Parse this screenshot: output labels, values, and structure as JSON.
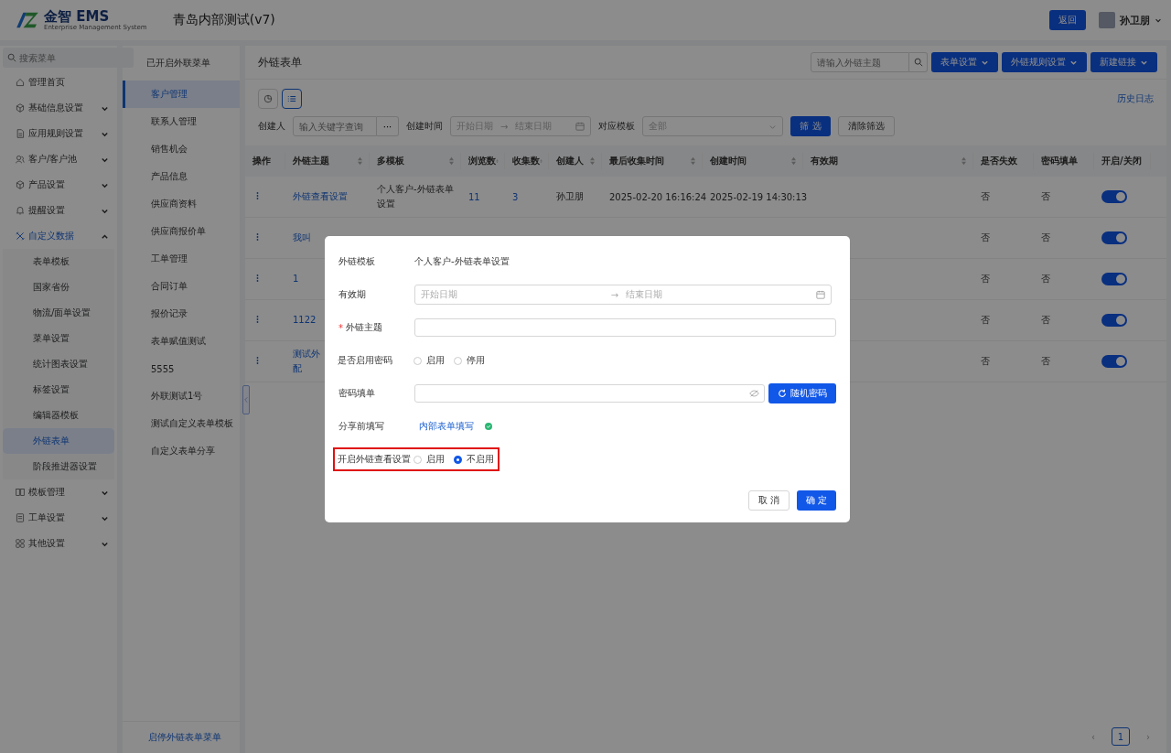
{
  "header": {
    "logo_text": "金智 EMS",
    "logo_subtitle": "Enterprise Management System",
    "title": "青岛内部测试(v7)",
    "back_button": "返回",
    "user_name": "孙卫朋"
  },
  "sidebar": {
    "search_placeholder": "搜索菜单",
    "items": [
      {
        "label": "管理首页",
        "kind": "link",
        "selected": false
      },
      {
        "label": "基础信息设置",
        "kind": "group",
        "expanded": false,
        "selected": false
      },
      {
        "label": "应用规则设置",
        "kind": "group",
        "expanded": false,
        "selected": false
      },
      {
        "label": "客户/客户池",
        "kind": "group",
        "expanded": false,
        "selected": false
      },
      {
        "label": "产品设置",
        "kind": "group",
        "expanded": false,
        "selected": false
      },
      {
        "label": "提醒设置",
        "kind": "group",
        "expanded": false,
        "selected": false
      },
      {
        "label": "自定义数据",
        "kind": "group",
        "expanded": true,
        "selected": true,
        "children": [
          {
            "label": "表单模板",
            "selected": false
          },
          {
            "label": "国家省份",
            "selected": false
          },
          {
            "label": "物流/面单设置",
            "selected": false
          },
          {
            "label": "菜单设置",
            "selected": false
          },
          {
            "label": "统计图表设置",
            "selected": false
          },
          {
            "label": "标签设置",
            "selected": false
          },
          {
            "label": "编辑器模板",
            "selected": false
          },
          {
            "label": "外链表单",
            "selected": true
          },
          {
            "label": "阶段推进器设置",
            "selected": false
          }
        ]
      },
      {
        "label": "模板管理",
        "kind": "group",
        "expanded": false,
        "selected": false
      },
      {
        "label": "工单设置",
        "kind": "group",
        "expanded": false,
        "selected": false
      },
      {
        "label": "其他设置",
        "kind": "group",
        "expanded": false,
        "selected": false
      }
    ]
  },
  "menu_panel": {
    "title": "已开启外联菜单",
    "items": [
      {
        "label": "客户管理",
        "selected": true
      },
      {
        "label": "联系人管理",
        "selected": false
      },
      {
        "label": "销售机会",
        "selected": false
      },
      {
        "label": "产品信息",
        "selected": false
      },
      {
        "label": "供应商资料",
        "selected": false
      },
      {
        "label": "供应商报价单",
        "selected": false
      },
      {
        "label": "工单管理",
        "selected": false
      },
      {
        "label": "合同订单",
        "selected": false
      },
      {
        "label": "报价记录",
        "selected": false
      },
      {
        "label": "表单赋值测试",
        "selected": false
      },
      {
        "label": "5555",
        "selected": false
      },
      {
        "label": "外联测试1号",
        "selected": false
      },
      {
        "label": "测试自定义表单模板",
        "selected": false
      },
      {
        "label": "自定义表单分享",
        "selected": false
      }
    ],
    "footer_link": "启停外链表单菜单"
  },
  "main": {
    "title": "外链表单",
    "search_placeholder": "请输入外链主题",
    "toolbar_buttons": [
      "表单设置",
      "外链规则设置",
      "新建链接"
    ],
    "views": [
      {
        "kind": "chart",
        "selected": false
      },
      {
        "kind": "list",
        "selected": true
      }
    ],
    "history_link": "历史日志",
    "filters": {
      "creator_label": "创建人",
      "creator_placeholder": "输入关键字查询",
      "more_button": "···",
      "time_label": "创建时间",
      "start_placeholder": "开始日期",
      "range_arrow": "→",
      "end_placeholder": "结束日期",
      "template_label": "对应模板",
      "template_value": "全部",
      "filter_button": "筛 选",
      "clear_button": "清除筛选"
    },
    "table": {
      "columns": [
        {
          "label": "操作",
          "sortable": false
        },
        {
          "label": "外链主题",
          "sortable": true
        },
        {
          "label": "多模板",
          "sortable": true
        },
        {
          "label": "浏览数",
          "sortable": true
        },
        {
          "label": "收集数",
          "sortable": true
        },
        {
          "label": "创建人",
          "sortable": true
        },
        {
          "label": "最后收集时间",
          "sortable": true
        },
        {
          "label": "创建时间",
          "sortable": true
        },
        {
          "label": "有效期",
          "sortable": true
        },
        {
          "label": "是否失效",
          "sortable": false
        },
        {
          "label": "密码填单",
          "sortable": false
        },
        {
          "label": "开启/关闭",
          "sortable": false
        }
      ],
      "rows": [
        {
          "subject": "外链查看设置",
          "template": "个人客户-外链表单设置",
          "views": "11",
          "collected": "3",
          "creator": "孙卫朋",
          "last_collected": "2025-02-20 16:16:24",
          "created": "2025-02-19 14:30:13",
          "invalid": "否",
          "password_form": "否",
          "on": true
        },
        {
          "subject": "我叫",
          "invalid": "否",
          "password_form": "否",
          "on": true
        },
        {
          "subject": "1",
          "invalid": "否",
          "password_form": "否",
          "on": true
        },
        {
          "subject": "1122",
          "invalid": "否",
          "password_form": "否",
          "on": true
        },
        {
          "subject": "测试外配",
          "invalid": "否",
          "password_form": "否",
          "on": true
        }
      ]
    },
    "pagination": {
      "prev": "‹",
      "pages": [
        {
          "label": "1",
          "selected": true
        }
      ],
      "next": "›"
    }
  },
  "dialog": {
    "fields": [
      {
        "kind": "text",
        "label": "外链模板",
        "value": "个人客户-外链表单设置"
      },
      {
        "kind": "daterange",
        "label": "有效期",
        "start_placeholder": "开始日期",
        "arrow": "→",
        "end_placeholder": "结束日期"
      },
      {
        "kind": "input",
        "label": "外链主题",
        "required_mark": "*"
      },
      {
        "kind": "radio",
        "label": "是否启用密码",
        "highlighted": false,
        "options": [
          {
            "label": "启用",
            "selected": false
          },
          {
            "label": "停用",
            "selected": false
          }
        ]
      },
      {
        "kind": "password",
        "label": "密码填单",
        "button": "随机密码"
      },
      {
        "kind": "link",
        "label": "分享前填写",
        "link": "内部表单填写",
        "done": true
      },
      {
        "kind": "radio",
        "label": "开启外链查看设置",
        "highlighted": true,
        "options": [
          {
            "label": "启用",
            "selected": false
          },
          {
            "label": "不启用",
            "selected": true
          }
        ]
      }
    ],
    "cancel_button": "取 消",
    "ok_button": "确 定"
  }
}
